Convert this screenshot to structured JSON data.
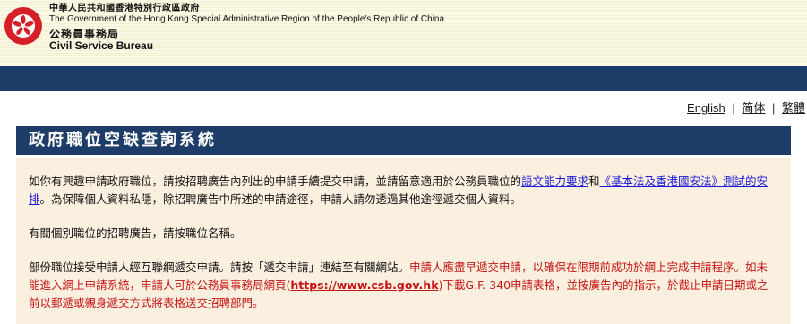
{
  "header": {
    "gov_name_zh": "中華人民共和國香港特別行政區政府",
    "gov_name_en": "The Government of the Hong Kong Special Administrative Region of the People's Republic of China",
    "dept_name_zh": "公務員事務局",
    "dept_name_en": "Civil Service Bureau"
  },
  "lang": {
    "english": "English",
    "simplified": "简体",
    "traditional": "繁體",
    "separator": "|"
  },
  "page_title": "政府職位空缺查詢系統",
  "notice": {
    "p1_a": "如你有興趣申請政府職位，請按招聘廣告內列出的申請手續提交申請，並請留意適用於公務員職位的",
    "p1_link1": "語文能力要求",
    "p1_and": "和",
    "p1_link2": "《基本法及香港國安法》測試的安排",
    "p1_b": "。為保障個人資料私隱，除招聘廣告中所述的申請途徑，申請人請勿透過其他途徑遞交個人資料。",
    "p2": "有關個別職位的招聘廣告，請按職位名稱。",
    "p3_a": "部份職位接受申請人經互聯網遞交申請。請按「遞交申請」連結至有關網站。",
    "p3_red_a": "申請人應盡早遞交申請，以確保在限期前成功於網上完成申請程序。如未能進入網上申請系統，申請人可於公務員事務局網頁(",
    "p3_red_link": "https://www.csb.gov.hk",
    "p3_red_b": ")下載G.F. 340申請表格，並按廣告內的指示，於截止申請日期或之前以郵遞或親身遞交方式將表格送交招聘部門。"
  },
  "colors": {
    "nav_blue": "#1d3c68",
    "notice_bg": "#fbf0e0",
    "alert_red": "#c41414",
    "link_blue": "#1a1ad6"
  }
}
